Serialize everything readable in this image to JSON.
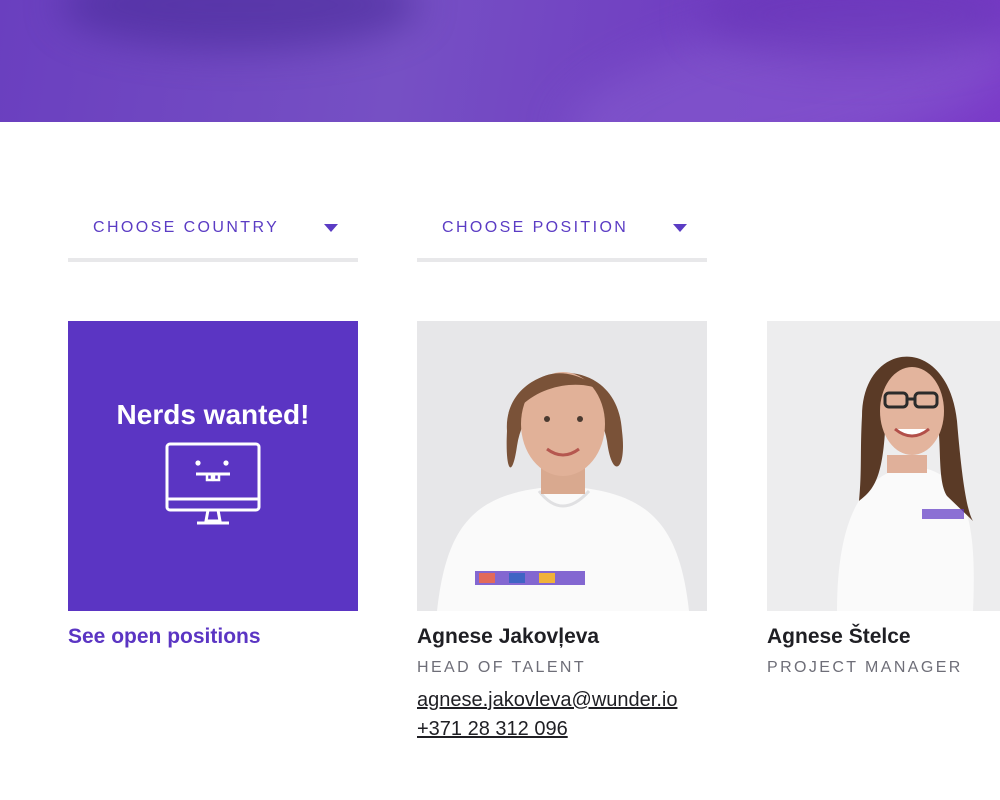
{
  "filters": {
    "country": "CHOOSE COUNTRY",
    "position": "CHOOSE POSITION"
  },
  "nerds": {
    "title": "Nerds wanted!",
    "link": "See open positions"
  },
  "people": [
    {
      "name": "Agnese Jakovļeva",
      "role": "HEAD OF TALENT",
      "email": "agnese.jakovleva@wunder.io",
      "phone": "+371 28 312 096"
    },
    {
      "name": "Agnese Štelce",
      "role": "PROJECT MANAGER"
    }
  ],
  "colors": {
    "accent": "#5b35c3",
    "hero": "#7650c4",
    "divider": "#e8e8ea"
  }
}
